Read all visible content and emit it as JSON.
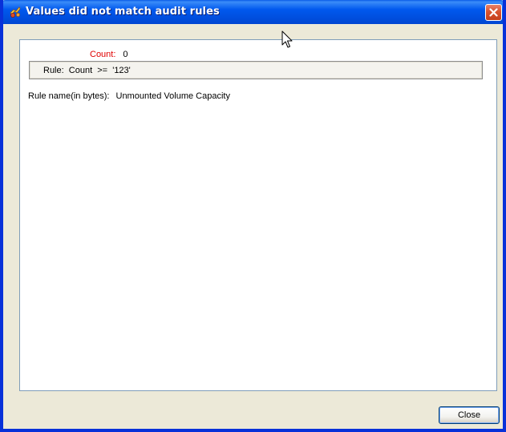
{
  "window": {
    "title": "Values did not match audit rules",
    "title_icon": "app-icon",
    "close_icon": "close-icon"
  },
  "details": {
    "count_label": "Count:",
    "count_value": "0",
    "rule_text": "Rule:  Count  >=  '123'",
    "rule_name_label": "Rule name(in bytes):",
    "rule_name_value": "Unmounted Volume Capacity"
  },
  "buttons": {
    "close_label": "Close"
  },
  "colors": {
    "titlebar": "#0058ee",
    "count_label": "#e00000",
    "window_bg": "#ece9d8",
    "content_border": "#7f9db9"
  }
}
